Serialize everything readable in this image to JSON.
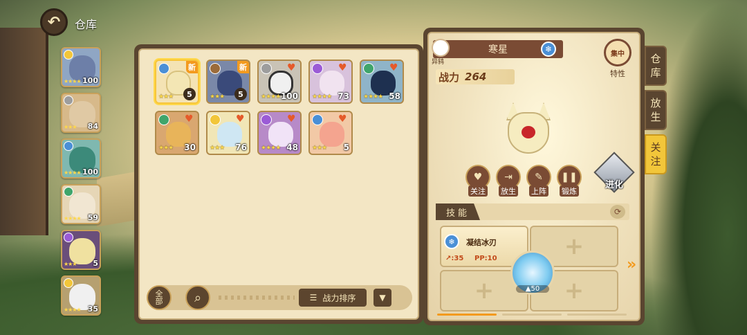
{
  "header": {
    "title": "仓库",
    "back_icon": "back-arrow-icon"
  },
  "party": [
    {
      "level": "100",
      "stars": "★★★★",
      "element_color": "#f2c63a",
      "creature_color": "#6d7fa8"
    },
    {
      "level": "84",
      "stars": "★★★",
      "element_color": "#9d9d9d",
      "creature_color": "#e0c9a4"
    },
    {
      "level": "100",
      "stars": "★★★★",
      "element_color": "#4a8fd6",
      "creature_color": "#3c8a7a"
    },
    {
      "level": "59",
      "stars": "★★★★",
      "element_color": "#3fa56b",
      "creature_color": "#f1e6d2"
    },
    {
      "level": "5",
      "stars": "★★★",
      "element_color": "#9b5bd6",
      "creature_color": "#f0e1a0"
    },
    {
      "level": "35",
      "stars": "★★★★",
      "element_color": "#f2c63a",
      "creature_color": "#f0f0f0"
    }
  ],
  "storage": {
    "cards": [
      {
        "level": "5",
        "stars": "★★★",
        "element_color": "#4a8fd6",
        "badge": "新",
        "creature_color": "#f3e6b4",
        "selected": true
      },
      {
        "level": "5",
        "stars": "★★★",
        "element_color": "#9b6b3a",
        "badge": "新",
        "creature_color": "#3a4a7a",
        "selected": false
      },
      {
        "level": "100",
        "stars": "★★★★",
        "element_color": "#9d9d9d",
        "heart": "♥",
        "creature_color": "#f0f0f0",
        "selected": false
      },
      {
        "level": "73",
        "stars": "★★★★",
        "element_color": "#9b5bd6",
        "heart": "♥",
        "creature_color": "#f1e3f0",
        "selected": false
      },
      {
        "level": "58",
        "stars": "★★★★",
        "element_color": "#3fa56b",
        "heart": "♥",
        "creature_color": "#1e3050",
        "selected": false
      },
      {
        "level": "30",
        "stars": "★★★",
        "element_color": "#3fa56b",
        "heart": "♥",
        "creature_color": "#e8b45a",
        "selected": false
      },
      {
        "level": "76",
        "stars": "★★★",
        "element_color": "#f2c63a",
        "heart": "♥",
        "creature_color": "#cfe7f3",
        "selected": false
      },
      {
        "level": "48",
        "stars": "★★★★",
        "element_color": "#9b5bd6",
        "heart": "♥",
        "creature_color": "#f1e3f7",
        "selected": false
      },
      {
        "level": "5",
        "stars": "★★★",
        "element_color": "#4a8fd6",
        "heart": "♥",
        "creature_color": "#f4a48f",
        "selected": false
      }
    ],
    "filter_label_top": "全",
    "filter_label_bottom": "部",
    "search_icon": "search-icon",
    "sort_label": "战力排序",
    "sort_icon": "☰",
    "sort_arrow": "▼"
  },
  "detail": {
    "name": "寒星",
    "type_label": "异鸫",
    "name_element_glyph": "❄",
    "power_label": "战力",
    "power_value": "264",
    "trait_icon_text": "集中",
    "trait_label": "特性",
    "actions": [
      {
        "label": "关注",
        "glyph": "♥"
      },
      {
        "label": "放生",
        "glyph": "⇥"
      },
      {
        "label": "上阵",
        "glyph": "✎"
      },
      {
        "label": "锻炼",
        "glyph": "❚❚"
      }
    ],
    "evolve_label": "进化",
    "skills_title": "技能",
    "skills_refresh_icon": "⟳",
    "skill": {
      "name": "凝结冰刃",
      "element_glyph": "❄",
      "power": "↗:35",
      "pp": "PP:10"
    },
    "empty_slot_glyph": "+",
    "orb_level": "▲50",
    "next_arrow": "»"
  },
  "side_tabs": [
    {
      "label_top": "仓",
      "label_bottom": "库",
      "active": false
    },
    {
      "label_top": "放",
      "label_bottom": "生",
      "active": false
    },
    {
      "label_top": "关",
      "label_bottom": "注",
      "active": true
    }
  ]
}
